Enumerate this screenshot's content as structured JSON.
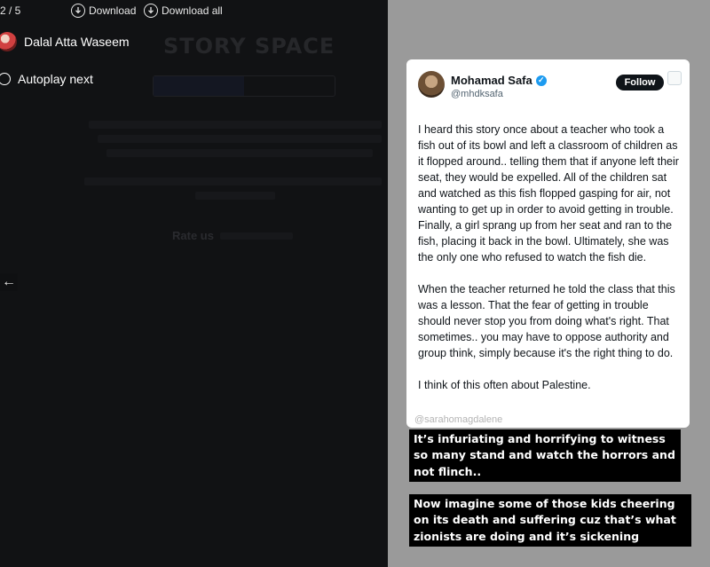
{
  "viewer": {
    "counter": "2 / 5",
    "download_label": "Download",
    "download_all_label": "Download all",
    "username": "Dalal Atta Waseem",
    "autoplay_label": "Autoplay next",
    "prev_icon": "arrow-left-icon"
  },
  "background_page": {
    "title": "STORY SPACE",
    "tabs": [
      "",
      ""
    ],
    "rate_label": "Rate us"
  },
  "tweet": {
    "name": "Mohamad Safa",
    "handle": "@mhdksafa",
    "follow_label": "Follow",
    "paragraphs": [
      "I heard this story once about a teacher who took a fish out of its bowl and left a classroom of children as it flopped around.. telling them that if anyone left their seat, they would be expelled. All of the children sat and watched as this fish flopped gasping for air, not wanting to get up in order to avoid getting in trouble. Finally, a girl sprang up from her seat and ran to the fish, placing it back in the bowl. Ultimately, she was the only one who refused to watch the fish die.",
      "When the teacher returned he told the class that this was a lesson. That the fear of getting in trouble should never stop you from doing what's right. That sometimes.. you may have to oppose authority and group think, simply because it's the right thing to do.",
      "I think of this often about Palestine."
    ]
  },
  "story": {
    "mention": "@sarahomagdalene",
    "caption_1": "It’s infuriating and horrifying to witness so many stand and watch the horrors and not flinch..",
    "caption_2": "Now imagine some of those kids cheering on its death and suffering cuz that’s what zionists are doing and it’s sickening"
  },
  "colors": {
    "overlay_bg": "#0b0b0c",
    "story_bg": "#9a9a9a",
    "verified": "#1d9bf0",
    "follow_bg": "#0f1419"
  }
}
